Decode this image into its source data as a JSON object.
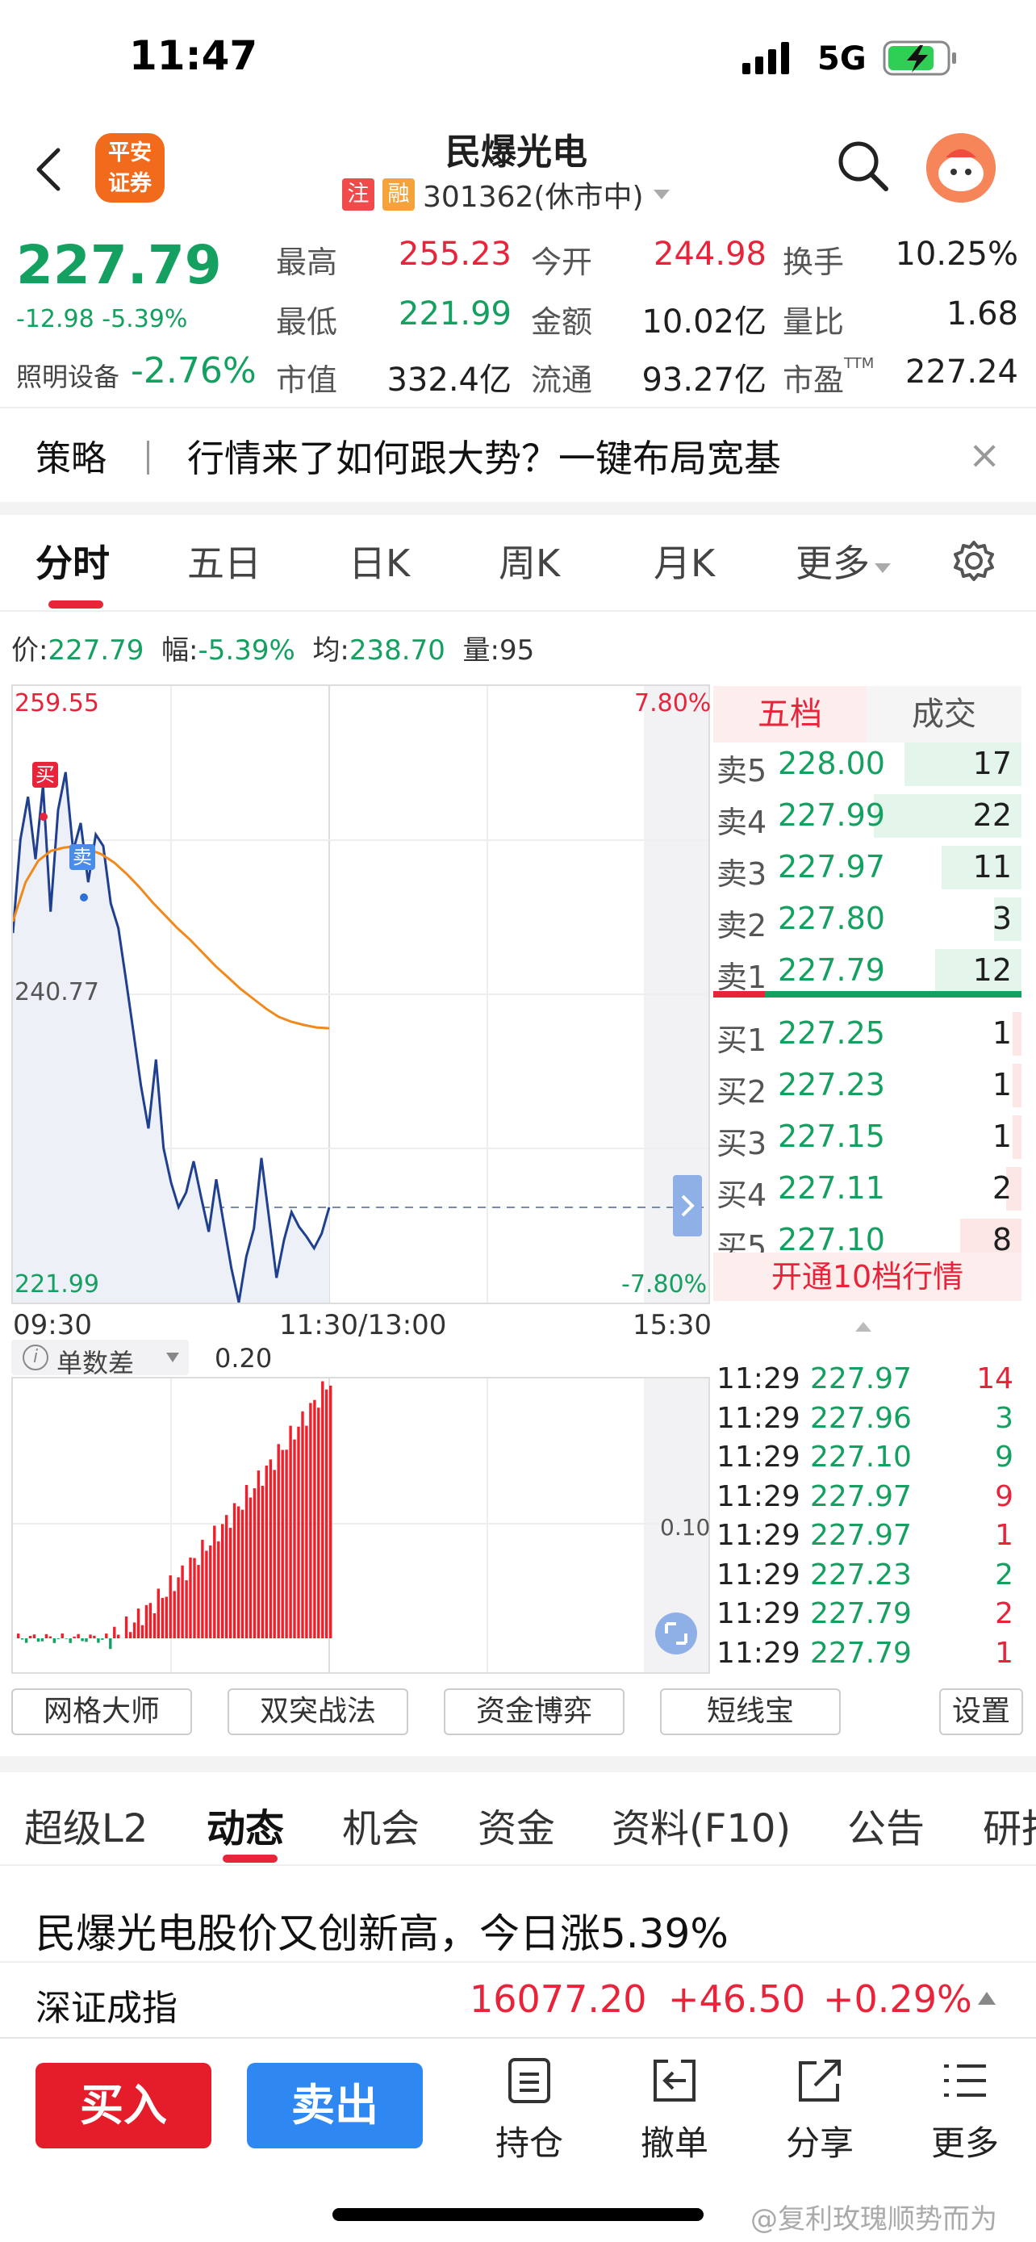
{
  "status_bar": {
    "time": "11:47",
    "network": "5G"
  },
  "header": {
    "broker_logo": "平安\n证券",
    "stock_name": "民爆光电",
    "tag_zhu": "注",
    "tag_rong": "融",
    "code_status": "301362(休市中)",
    "search_icon": "search-icon",
    "back_icon": "chevron-left-icon",
    "avatar_icon": "mascot-avatar"
  },
  "quote": {
    "price": "227.79",
    "change": "-12.98",
    "change_pct": "-5.39%",
    "sector_name": "照明设备",
    "sector_change": "-2.76%",
    "fields": [
      {
        "label": "最高",
        "value": "255.23",
        "color": "red"
      },
      {
        "label": "今开",
        "value": "244.98",
        "color": "red"
      },
      {
        "label": "换手",
        "value": "10.25%",
        "color": "black"
      },
      {
        "label": "最低",
        "value": "221.99",
        "color": "green"
      },
      {
        "label": "金额",
        "value": "10.02亿",
        "color": "black"
      },
      {
        "label": "量比",
        "value": "1.68",
        "color": "black"
      },
      {
        "label": "市值",
        "value": "332.4亿",
        "color": "black"
      },
      {
        "label": "流通",
        "value": "93.27亿",
        "color": "black"
      },
      {
        "label": "市盈",
        "value": "227.24",
        "color": "black",
        "sup": "TTM"
      }
    ]
  },
  "strategy": {
    "label": "策略",
    "text": "行情来了如何跟大势？一键布局宽基",
    "close": "×"
  },
  "chart_tabs": [
    "分时",
    "五日",
    "日K",
    "周K",
    "月K",
    "更多"
  ],
  "chart_info": {
    "price_label": "价:",
    "price": "227.79",
    "amp_label": "幅:",
    "amp": "-5.39%",
    "avg_label": "均:",
    "avg": "238.70",
    "vol_label": "量:",
    "vol": "95"
  },
  "chart_data": {
    "type": "line",
    "y_top": "259.55",
    "y_mid": "240.77",
    "y_bottom": "221.99",
    "pct_top": "7.80%",
    "pct_bottom": "-7.80%",
    "x_labels": [
      "09:30",
      "11:30/13:00",
      "15:30"
    ],
    "ylim": [
      221.99,
      259.55
    ],
    "series": [
      {
        "color": "#1f3f8f",
        "values": [
          244.5,
          250.2,
          252.8,
          249.0,
          253.5,
          245.8,
          252.0,
          254.3,
          249.5,
          251.2,
          247.6,
          250.5,
          249.8,
          246.3,
          244.8,
          241.7,
          238.5,
          235.2,
          232.6,
          236.8,
          231.4,
          229.3,
          227.8,
          228.7,
          230.6,
          228.4,
          226.3,
          229.5,
          226.8,
          224.1,
          222.0,
          224.8,
          226.5,
          230.8,
          227.2,
          223.5,
          225.8,
          227.5,
          226.6,
          226.0,
          225.3,
          226.2,
          227.79
        ]
      },
      {
        "color": "#f08a1d",
        "values": [
          245.2,
          247.6,
          248.9,
          249.5,
          249.7,
          249.8,
          249.6,
          249.3,
          248.8,
          248.1,
          247.3,
          246.4,
          245.6,
          244.8,
          244.1,
          243.3,
          242.5,
          241.8,
          241.1,
          240.5,
          239.9,
          239.4,
          239.1,
          238.9,
          238.75,
          238.7
        ]
      }
    ],
    "markers": [
      {
        "label": "买"
      },
      {
        "label": "卖"
      }
    ]
  },
  "order_book": {
    "tab_active": "五档",
    "tab_other": "成交",
    "sells": [
      {
        "label": "卖5",
        "price": "228.00",
        "vol": "17",
        "depth": 0.38
      },
      {
        "label": "卖4",
        "price": "227.99",
        "vol": "22",
        "depth": 0.48
      },
      {
        "label": "卖3",
        "price": "227.97",
        "vol": "11",
        "depth": 0.26
      },
      {
        "label": "卖2",
        "price": "227.80",
        "vol": "3",
        "depth": 0.09
      },
      {
        "label": "卖1",
        "price": "227.79",
        "vol": "12",
        "depth": 0.28
      }
    ],
    "buys": [
      {
        "label": "买1",
        "price": "227.25",
        "vol": "1",
        "depth": 0.03
      },
      {
        "label": "买2",
        "price": "227.23",
        "vol": "1",
        "depth": 0.03
      },
      {
        "label": "买3",
        "price": "227.15",
        "vol": "1",
        "depth": 0.03
      },
      {
        "label": "买4",
        "price": "227.11",
        "vol": "2",
        "depth": 0.05
      },
      {
        "label": "买5",
        "price": "227.10",
        "vol": "8",
        "depth": 0.2
      }
    ],
    "upgrade": "开通10档行情",
    "trades": [
      {
        "time": "11:29",
        "price": "227.97",
        "vol": "14",
        "color": "red"
      },
      {
        "time": "11:29",
        "price": "227.96",
        "vol": "3",
        "color": "green"
      },
      {
        "time": "11:29",
        "price": "227.10",
        "vol": "9",
        "color": "green"
      },
      {
        "time": "11:29",
        "price": "227.97",
        "vol": "9",
        "color": "red"
      },
      {
        "time": "11:29",
        "price": "227.97",
        "vol": "1",
        "color": "red"
      },
      {
        "time": "11:29",
        "price": "227.23",
        "vol": "2",
        "color": "green"
      },
      {
        "time": "11:29",
        "price": "227.79",
        "vol": "2",
        "color": "red"
      },
      {
        "time": "11:29",
        "price": "227.79",
        "vol": "1",
        "color": "red"
      }
    ]
  },
  "indicator": {
    "name": "单数差",
    "value": "0.20",
    "mid_label": "0.10"
  },
  "tools": [
    "网格大师",
    "双突战法",
    "资金博弈",
    "短线宝",
    "设置"
  ],
  "news_tabs": [
    "超级L2",
    "动态",
    "机会",
    "资金",
    "资料(F10)",
    "公告",
    "研报"
  ],
  "headline": "民爆光电股价又创新高，今日涨5.39%",
  "index": {
    "name": "深证成指",
    "value": "16077.20",
    "change": "+46.50",
    "pct": "+0.29%"
  },
  "bottom": {
    "buy": "买入",
    "sell": "卖出",
    "actions": [
      {
        "icon": "position-icon",
        "label": "持仓"
      },
      {
        "icon": "cancel-order-icon",
        "label": "撤单"
      },
      {
        "icon": "share-icon",
        "label": "分享"
      },
      {
        "icon": "more-menu-icon",
        "label": "更多"
      }
    ]
  },
  "watermark": "@复利玫瑰顺势而为"
}
